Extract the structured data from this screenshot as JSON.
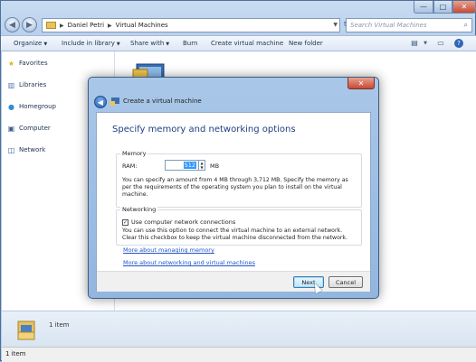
{
  "window": {
    "controls": {
      "minimize": "—",
      "maximize": "□",
      "close": "✕"
    }
  },
  "address_bar": {
    "segments": [
      "Daniel Petri",
      "Virtual Machines"
    ],
    "search_placeholder": "Search Virtual Machines"
  },
  "toolbar": {
    "organize": "Organize",
    "include_in_library": "Include in library",
    "share_with": "Share with",
    "burn": "Burn",
    "create_vm": "Create virtual machine",
    "new_folder": "New folder"
  },
  "nav_pane": {
    "items": [
      {
        "label": "Favorites",
        "icon": "star-icon"
      },
      {
        "label": "Libraries",
        "icon": "library-icon"
      },
      {
        "label": "Homegroup",
        "icon": "homegroup-icon"
      },
      {
        "label": "Computer",
        "icon": "computer-icon"
      },
      {
        "label": "Network",
        "icon": "network-icon"
      }
    ]
  },
  "details_pane": {
    "item_count": "1 item"
  },
  "status_bar": {
    "text": "1 item"
  },
  "dialog": {
    "title": "Create a virtual machine",
    "heading": "Specify memory and networking options",
    "memory": {
      "group_label": "Memory",
      "ram_label": "RAM:",
      "ram_value": "512",
      "unit": "MB",
      "description": "You can specify an amount from 4 MB through 3,712 MB. Specify the memory as per the requirements of the operating system you plan to install on the virtual machine."
    },
    "networking": {
      "group_label": "Networking",
      "checkbox_label": "Use computer network connections",
      "checked": true,
      "description": "You can use this option to connect the virtual machine to an external network. Clear this checkbox to keep the virtual machine disconnected from the network."
    },
    "links": [
      "More about managing memory",
      "More about networking and virtual machines"
    ],
    "buttons": {
      "next": "Next",
      "cancel": "Cancel"
    }
  },
  "colors": {
    "accent": "#1f3f80",
    "link": "#1f55c8",
    "close": "#c74a33"
  }
}
